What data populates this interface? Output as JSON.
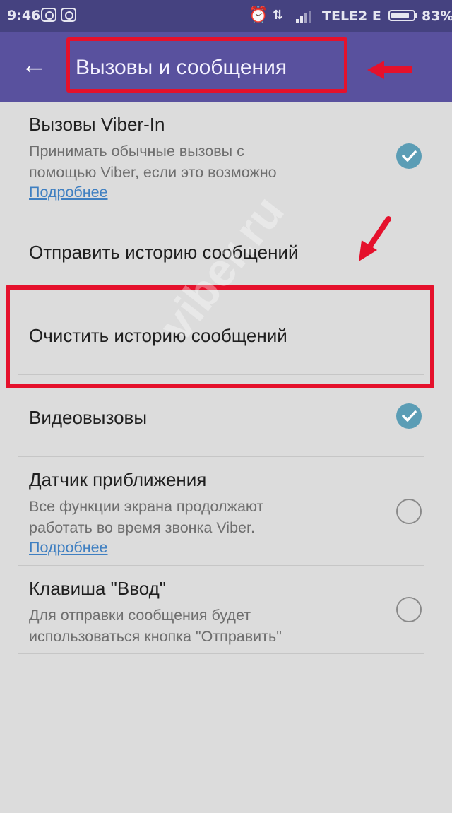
{
  "status_bar": {
    "time": "9:46",
    "carrier": "TELE2 E",
    "battery_percent": "83%",
    "battery_level": 0.83,
    "icons": [
      "viber-icon",
      "viber-icon",
      "alarm-icon",
      "vibrate-icon",
      "signal-icon",
      "battery-icon"
    ]
  },
  "app_bar": {
    "back_icon": "back-arrow-icon",
    "title": "Вызовы и сообщения",
    "background_color": "#59519e"
  },
  "settings": [
    {
      "title": "Вызовы Viber-In",
      "description_lines": [
        "Принимать обычные вызовы с",
        "помощью Viber, если это возможно"
      ],
      "link": "Подробнее",
      "checked": true
    },
    {
      "title": "Отправить историю сообщений"
    },
    {
      "title": "Очистить историю сообщений"
    },
    {
      "title": "Видеовызовы",
      "checked": true
    },
    {
      "title": "Датчик приближения",
      "description_lines": [
        "Все функции экрана продолжают",
        "работать во время звонка Viber."
      ],
      "link": "Подробнее",
      "checked": false
    },
    {
      "title": "Клавиша \"Ввод\"",
      "description_lines": [
        "Для отправки сообщения будет",
        "использоваться кнопка \"Отправить\""
      ],
      "checked": false
    }
  ],
  "watermark": "viber.ru",
  "colors": {
    "highlight": "#e5112c",
    "accent_check": "#5b9db5",
    "link": "#3f7fc1"
  }
}
